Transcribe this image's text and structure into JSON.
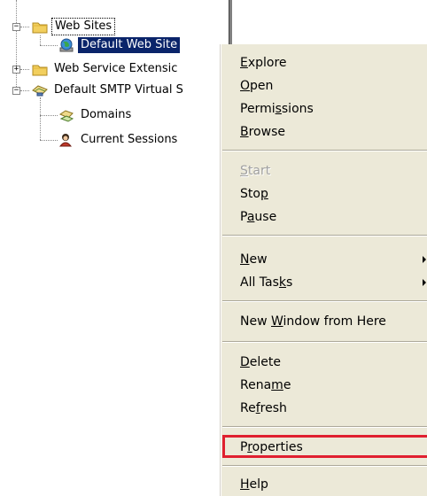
{
  "tree": {
    "nodes": [
      {
        "key": "web_sites",
        "label": "Web Sites",
        "expander": "−"
      },
      {
        "key": "default_web_site",
        "label": "Default Web Site"
      },
      {
        "key": "web_service_ext",
        "label": "Web Service Extensic",
        "expander": "+"
      },
      {
        "key": "smtp",
        "label": "Default SMTP Virtual S",
        "expander": "−"
      },
      {
        "key": "domains",
        "label": "Domains"
      },
      {
        "key": "sessions",
        "label": "Current Sessions"
      }
    ]
  },
  "menu": {
    "explore": {
      "pre": "",
      "ul": "E",
      "post": "xplore"
    },
    "open": {
      "pre": "",
      "ul": "O",
      "post": "pen"
    },
    "permissions": {
      "pre": "Permi",
      "ul": "s",
      "post": "sions"
    },
    "browse": {
      "pre": "",
      "ul": "B",
      "post": "rowse"
    },
    "start": {
      "pre": "",
      "ul": "S",
      "post": "tart"
    },
    "stop": {
      "pre": "Sto",
      "ul": "p",
      "post": ""
    },
    "pause": {
      "pre": "P",
      "ul": "a",
      "post": "use"
    },
    "new": {
      "pre": "",
      "ul": "N",
      "post": "ew"
    },
    "all_tasks": {
      "pre": "All Tas",
      "ul": "k",
      "post": "s"
    },
    "new_window": {
      "pre": "New ",
      "ul": "W",
      "post": "indow from Here"
    },
    "delete": {
      "pre": "",
      "ul": "D",
      "post": "elete"
    },
    "rename": {
      "pre": "Rena",
      "ul": "m",
      "post": "e"
    },
    "refresh": {
      "pre": "Re",
      "ul": "f",
      "post": "resh"
    },
    "properties": {
      "pre": "P",
      "ul": "r",
      "post": "operties"
    },
    "help": {
      "pre": "",
      "ul": "H",
      "post": "elp"
    }
  },
  "colors": {
    "selection": "#0a246a",
    "menu_bg": "#ece9d8",
    "callout": "#e02030"
  },
  "icons": {
    "folder": "folder-icon",
    "globe": "globe-icon",
    "smtp": "smtp-server-icon",
    "domains": "domains-icon",
    "sessions": "sessions-icon"
  }
}
